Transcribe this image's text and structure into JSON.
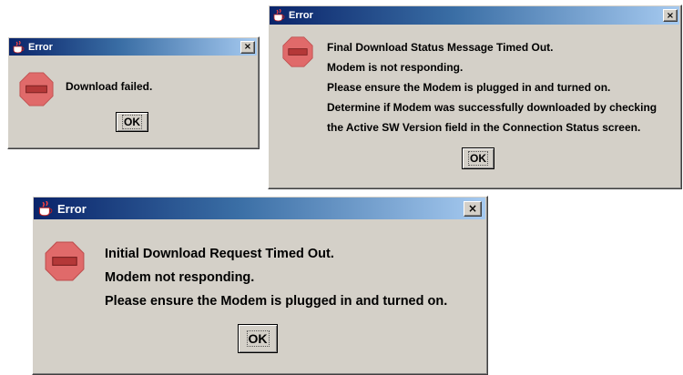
{
  "colors": {
    "titlebar_start": "#0a246a",
    "titlebar_end": "#a6caf0",
    "dialog_face": "#d4d0c8",
    "stop_sign": "#e06a6a"
  },
  "icons": {
    "app": "java-coffee-cup-icon",
    "close": "close-icon",
    "message": "stop-sign-icon"
  },
  "dialogs": [
    {
      "title": "Error",
      "close_label": "×",
      "message_lines": [
        "Download failed."
      ],
      "ok_label": "OK"
    },
    {
      "title": "Error",
      "close_label": "×",
      "message_lines": [
        "Final Download Status Message Timed Out.",
        "Modem is not responding.",
        "Please ensure the Modem is plugged in and turned on.",
        "Determine if Modem was successfully downloaded by checking",
        "the Active SW Version field in the Connection Status screen."
      ],
      "ok_label": "OK"
    },
    {
      "title": "Error",
      "close_label": "×",
      "message_lines": [
        "Initial Download Request Timed Out.",
        "Modem not responding.",
        "Please ensure the Modem is plugged in and turned on."
      ],
      "ok_label": "OK"
    }
  ]
}
